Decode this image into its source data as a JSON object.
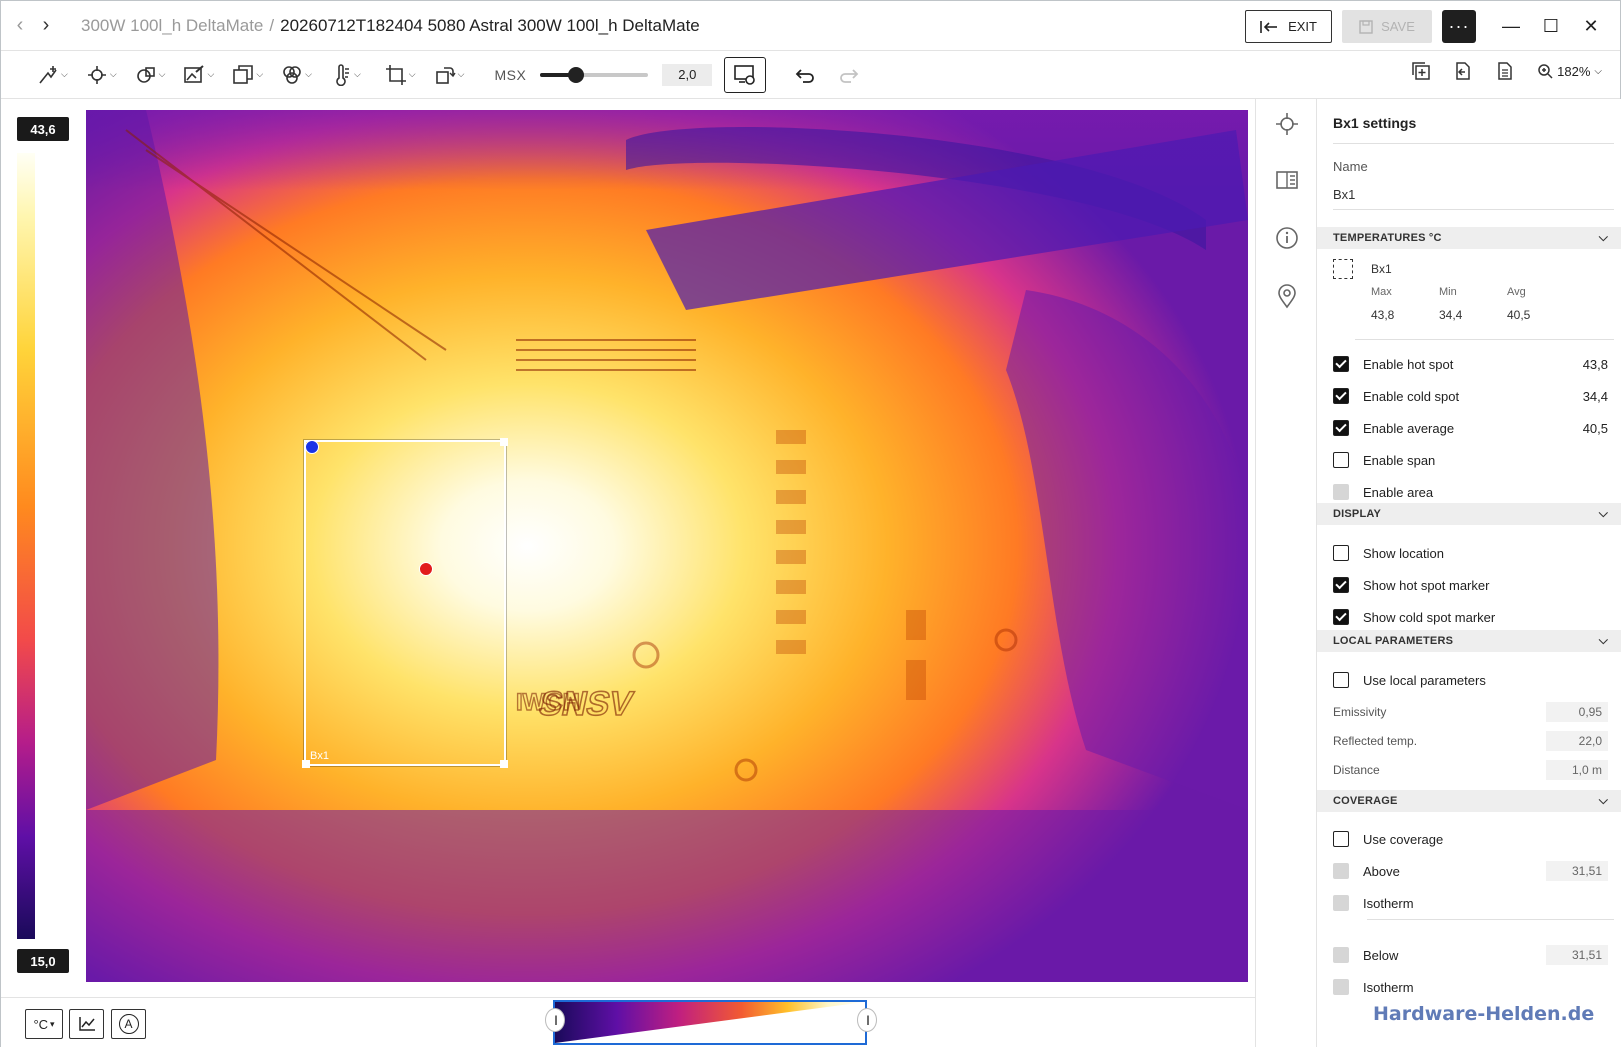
{
  "titlebar": {
    "breadcrumb_parent": "300W 100l_h DeltaMate",
    "breadcrumb_sep": "/",
    "breadcrumb_current": "20260712T182404 5080 Astral 300W 100l_h DeltaMate",
    "exit_label": "EXIT",
    "save_label": "SAVE",
    "more_label": "···"
  },
  "toolbar": {
    "msx_label": "MSX",
    "msx_value": "2,0",
    "msx_level": 0.33,
    "zoom_label": "182%"
  },
  "scale": {
    "max": "43,6",
    "min": "15,0"
  },
  "image": {
    "roi_label": "Bx1"
  },
  "panel": {
    "title": "Bx1 settings",
    "name_label": "Name",
    "name_value": "Bx1",
    "sections": {
      "temperatures": "TEMPERATURES °C",
      "display": "DISPLAY",
      "local_parameters": "LOCAL PARAMETERS",
      "coverage": "COVERAGE"
    },
    "stats": {
      "name": "Bx1",
      "max_label": "Max",
      "min_label": "Min",
      "avg_label": "Avg",
      "max": "43,8",
      "min": "34,4",
      "avg": "40,5"
    },
    "temp_options": [
      {
        "label": "Enable hot spot",
        "value": "43,8",
        "checked": true
      },
      {
        "label": "Enable cold spot",
        "value": "34,4",
        "checked": true
      },
      {
        "label": "Enable average",
        "value": "40,5",
        "checked": true
      },
      {
        "label": "Enable span",
        "value": "",
        "checked": false
      },
      {
        "label": "Enable area",
        "value": "",
        "checked": false
      }
    ],
    "display_options": [
      {
        "label": "Show location",
        "checked": false
      },
      {
        "label": "Show hot spot marker",
        "checked": true
      },
      {
        "label": "Show cold spot marker",
        "checked": true
      }
    ],
    "local": {
      "use_label": "Use local parameters",
      "emissivity_label": "Emissivity",
      "emissivity": "0,95",
      "reflected_label": "Reflected temp.",
      "reflected": "22,0",
      "distance_label": "Distance",
      "distance": "1,0 m"
    },
    "coverage": {
      "use_label": "Use coverage",
      "above_label": "Above",
      "above_value": "31,51",
      "isotherm1_label": "Isotherm",
      "below_label": "Below",
      "below_value": "31,51",
      "isotherm2_label": "Isotherm"
    }
  },
  "bottombar": {
    "unit_label": "°C",
    "unit_caret": "▾",
    "auto_label": "A"
  },
  "watermark": "Hardware-Helden.de"
}
